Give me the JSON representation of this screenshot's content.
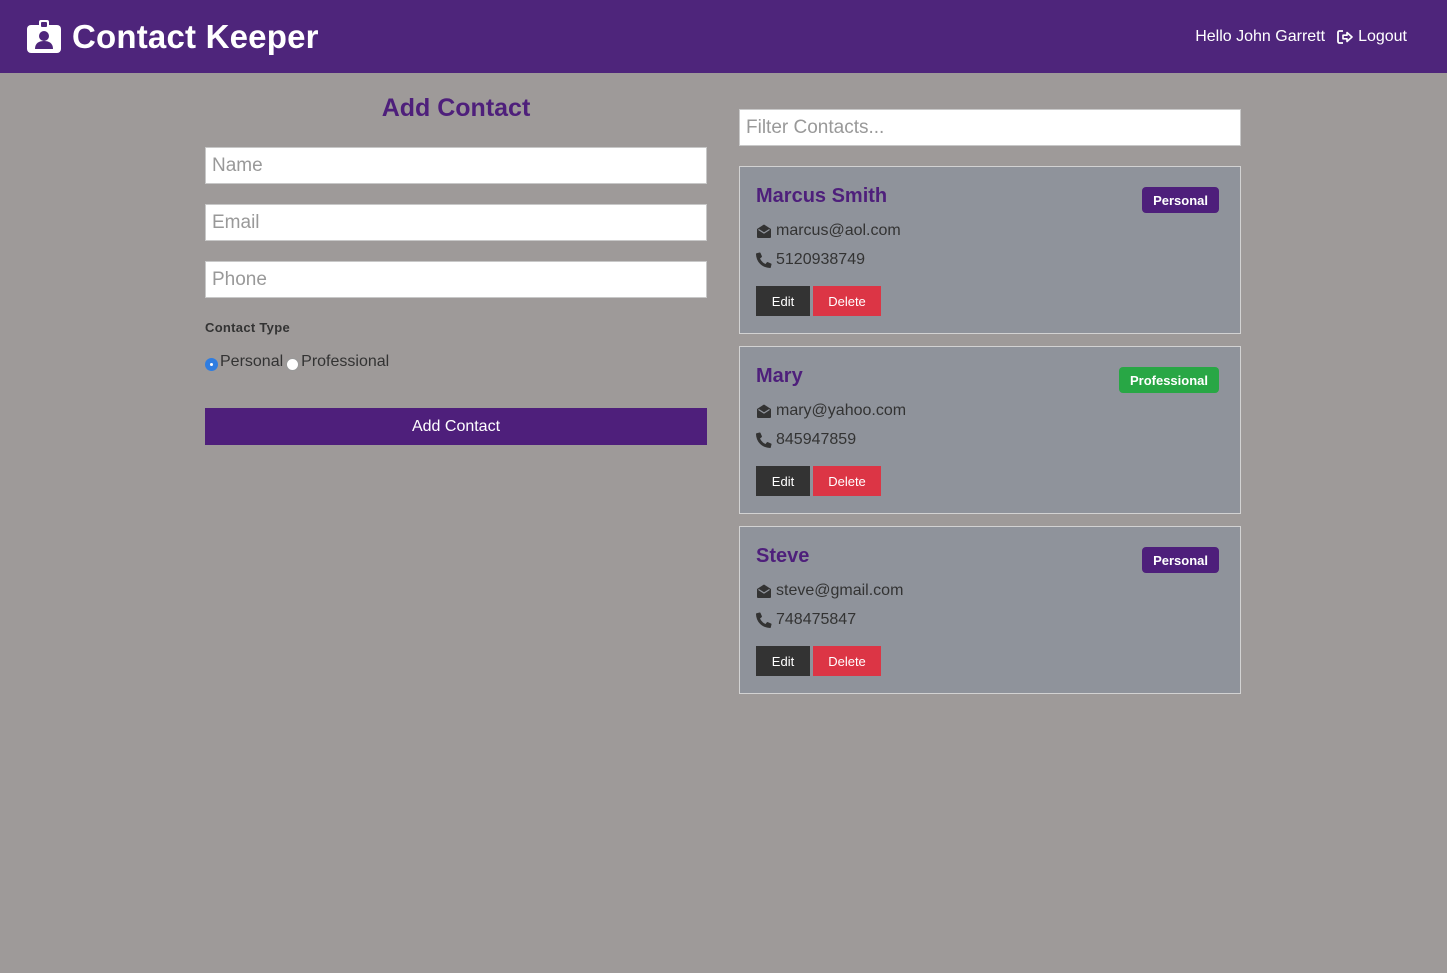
{
  "navbar": {
    "title": "Contact Keeper",
    "greeting": "Hello John Garrett",
    "logout_label": "Logout",
    "icon": "id-badge-icon",
    "background": "#4e257b"
  },
  "form": {
    "title": "Add Contact",
    "name_placeholder": "Name",
    "email_placeholder": "Email",
    "phone_placeholder": "Phone",
    "name_value": "",
    "email_value": "",
    "phone_value": "",
    "contact_type_label": "Contact Type",
    "type_options": [
      "Personal",
      "Professional"
    ],
    "selected_type": "Personal",
    "submit_label": "Add Contact"
  },
  "filter": {
    "placeholder": "Filter Contacts...",
    "value": ""
  },
  "contacts": [
    {
      "name": "Marcus Smith",
      "type": "Personal",
      "email": "marcus@aol.com",
      "phone": "5120938749",
      "edit_label": "Edit",
      "delete_label": "Delete"
    },
    {
      "name": "Mary",
      "type": "Professional",
      "email": "mary@yahoo.com",
      "phone": "845947859",
      "edit_label": "Edit",
      "delete_label": "Delete"
    },
    {
      "name": "Steve",
      "type": "Personal",
      "email": "steve@gmail.com",
      "phone": "748475847",
      "edit_label": "Edit",
      "delete_label": "Delete"
    }
  ],
  "colors": {
    "primary": "#4e1f7b",
    "success": "#28a745",
    "danger": "#dc3545",
    "dark": "#333333",
    "page_background": "#9e9a99",
    "card_background": "#8f939b"
  }
}
